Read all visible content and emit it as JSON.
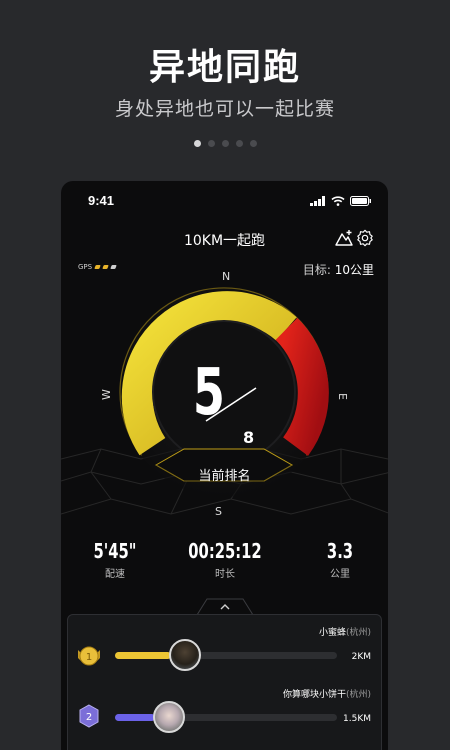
{
  "promo": {
    "title": "异地同跑",
    "subtitle": "身处异地也可以一起比赛",
    "page_count": 5,
    "active_page": 1
  },
  "status_bar": {
    "time": "9:41"
  },
  "nav": {
    "title": "10KM一起跑",
    "share_icon": "runner-plus-icon",
    "settings_icon": "gear-icon"
  },
  "gps": {
    "label": "GPS",
    "strength": 2,
    "max": 3
  },
  "target": {
    "label": "目标:",
    "value": "10公里"
  },
  "gauge": {
    "compass": {
      "n": "N",
      "s": "S",
      "e": "E",
      "w": "W"
    },
    "rank": "5",
    "total": "8",
    "rank_label": "当前排名",
    "colors": {
      "yellow": "#e8d026",
      "red": "#c8161a"
    }
  },
  "stats": [
    {
      "value": "5'45\"",
      "label": "配速"
    },
    {
      "value": "00:25:12",
      "label": "时长"
    },
    {
      "value": "3.3",
      "label": "公里"
    }
  ],
  "runners": [
    {
      "rank": "1",
      "name": "小蜜蜂",
      "city": "(杭州)",
      "distance": "2KM",
      "progress": 0.25,
      "color": "#ecc534",
      "badge": "gold"
    },
    {
      "rank": "2",
      "name": "你算哪块小饼干",
      "city": "(杭州)",
      "distance": "1.5KM",
      "progress": 0.18,
      "color": "#6b62e8",
      "badge": "purple"
    }
  ]
}
